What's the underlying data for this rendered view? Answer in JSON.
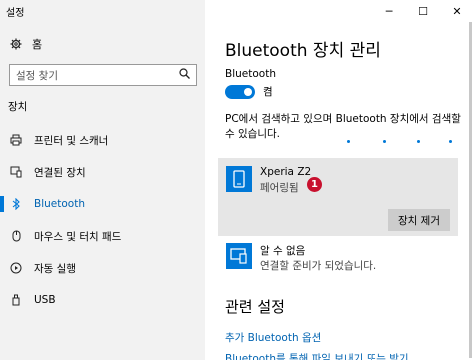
{
  "window": {
    "title": "설정",
    "minimize": "─",
    "maximize": "☐",
    "close": "✕"
  },
  "sidebar": {
    "home_label": "홈",
    "search_placeholder": "설정 찾기",
    "section_label": "장치",
    "items": [
      {
        "label": "프린터 및 스캐너",
        "icon": "printer-icon"
      },
      {
        "label": "연결된 장치",
        "icon": "connected-devices-icon"
      },
      {
        "label": "Bluetooth",
        "icon": "bluetooth-icon",
        "active": true
      },
      {
        "label": "마우스 및 터치 패드",
        "icon": "mouse-icon"
      },
      {
        "label": "자동 실행",
        "icon": "autoplay-icon"
      },
      {
        "label": "USB",
        "icon": "usb-icon"
      }
    ]
  },
  "main": {
    "title": "Bluetooth 장치 관리",
    "bluetooth_label": "Bluetooth",
    "toggle_state": "켬",
    "description": "PC에서 검색하고 있으며 Bluetooth 장치에서 검색할 수 있습니다.",
    "devices": [
      {
        "name": "Xperia Z2",
        "status": "페어링됨",
        "badge": "1",
        "action": "장치 제거",
        "icon": "phone-icon"
      },
      {
        "name": "알 수 없음",
        "status": "연결할 준비가 되었습니다.",
        "icon": "monitor-icon"
      }
    ],
    "related_title": "관련 설정",
    "links": [
      "추가 Bluetooth 옵션",
      "Bluetooth를 통해 파일 보내기 또는 받기"
    ]
  },
  "colors": {
    "accent": "#0078d7",
    "link": "#0063b1",
    "badge": "#c8102e"
  }
}
